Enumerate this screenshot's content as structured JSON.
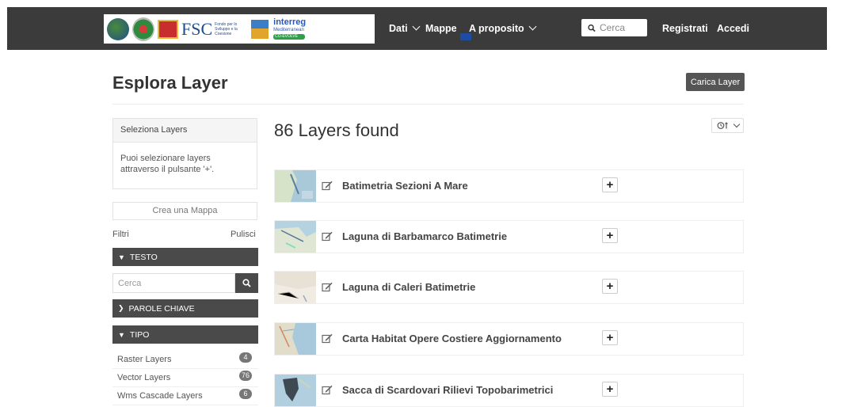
{
  "nav": {
    "logo_text": "FSC",
    "logo_subtext": "Fondo per lo Sviluppo e la Coesione",
    "interreg_title": "interreg",
    "interreg_sub": "Mediterranean",
    "interreg_project": "CO-EVOLVE",
    "items": [
      {
        "label": "Dati",
        "dropdown": true
      },
      {
        "label": "Mappe",
        "dropdown": false
      },
      {
        "label": "A proposito",
        "dropdown": true
      }
    ],
    "search_placeholder": "Cerca",
    "register_label": "Registrati",
    "login_label": "Accedi"
  },
  "page": {
    "title": "Esplora Layer",
    "upload_label": "Carica Layer"
  },
  "sidebar": {
    "panel_title": "Seleziona Layers",
    "panel_text": "Puoi selezionare layers attraverso il pulsante '+'.",
    "create_map_label": "Crea una Mappa",
    "filters_label": "Filtri",
    "clear_label": "Pulisci",
    "text_section": "TESTO",
    "search_placeholder": "Cerca",
    "keywords_section": "PAROLE CHIAVE",
    "type_section": "TIPO",
    "types": [
      {
        "label": "Raster Layers",
        "count": "4"
      },
      {
        "label": "Vector Layers",
        "count": "76"
      },
      {
        "label": "Wms Cascade Layers",
        "count": "6"
      }
    ]
  },
  "results": {
    "found_text": "86 Layers found",
    "layers": [
      {
        "title": "Batimetria Sezioni A Mare"
      },
      {
        "title": "Laguna di Barbamarco Batimetrie"
      },
      {
        "title": "Laguna di Caleri Batimetrie"
      },
      {
        "title": "Carta Habitat Opere Costiere Aggiornamento"
      },
      {
        "title": "Sacca di Scardovari Rilievi Topobarimetrici"
      }
    ]
  },
  "colors": {
    "navbar": "#3b3b3b",
    "accordion": "#4a4a4a",
    "badge": "#777777"
  }
}
